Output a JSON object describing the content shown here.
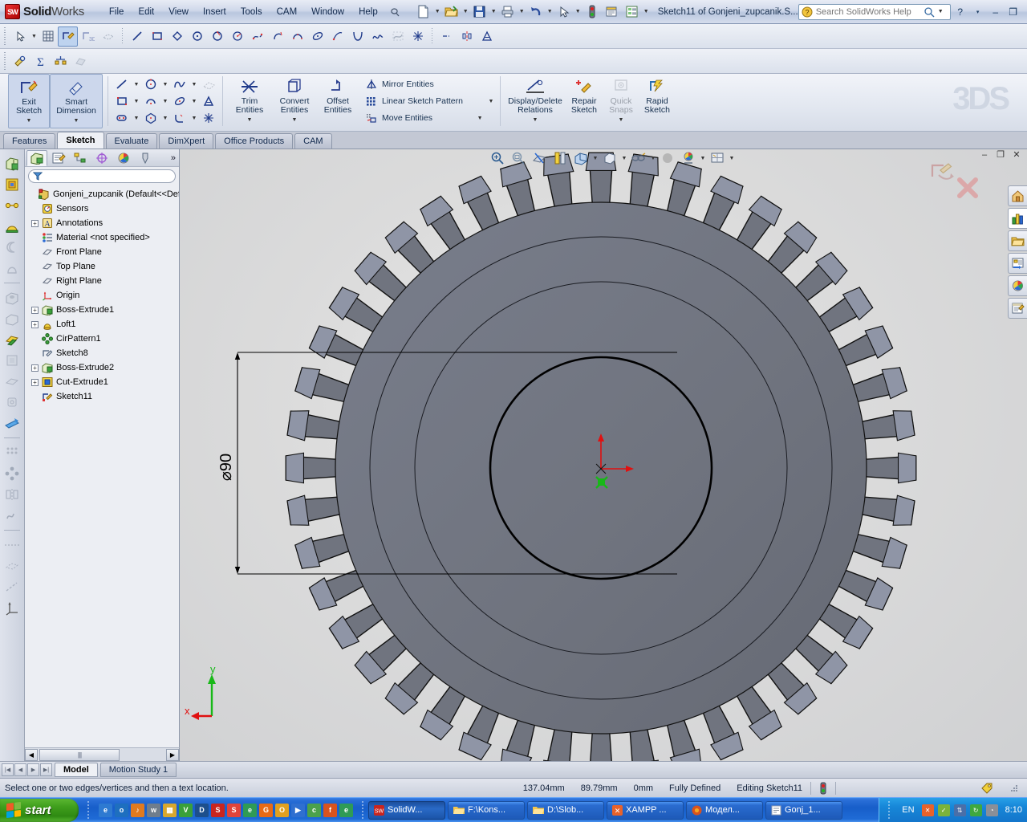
{
  "app": {
    "brand_bold": "Solid",
    "brand_light": "Works",
    "document_title": "Sketch11 of Gonjeni_zupcanik.S...",
    "accent": "#1f5cbb",
    "model_body_color": "#70747f",
    "model_tooth_light": "#8f95a6"
  },
  "menu": {
    "items": [
      {
        "label": "File"
      },
      {
        "label": "Edit"
      },
      {
        "label": "View"
      },
      {
        "label": "Insert"
      },
      {
        "label": "Tools"
      },
      {
        "label": "CAM"
      },
      {
        "label": "Window"
      },
      {
        "label": "Help"
      }
    ],
    "pin_icon": "pin-icon"
  },
  "quick_toolbar": {
    "items": [
      {
        "icon": "new-document-icon",
        "caret": true
      },
      {
        "icon": "open-folder-icon",
        "caret": true
      },
      {
        "icon": "save-icon",
        "caret": true
      },
      {
        "icon": "print-icon",
        "caret": true
      },
      {
        "icon": "undo-icon",
        "caret": true
      },
      {
        "icon": "select-arrow-icon",
        "caret": true
      },
      {
        "icon": "rebuild-icon",
        "caret": false
      },
      {
        "icon": "options-icon",
        "caret": false
      },
      {
        "icon": "document-properties-icon",
        "caret": true
      }
    ]
  },
  "search": {
    "placeholder": "Search SolidWorks Help",
    "icon": "help-search-icon",
    "magnifier_icon": "magnifier-icon",
    "dropdown_icon": "chevron-down-icon"
  },
  "window_controls": {
    "help": "?",
    "help_caret": "▾",
    "minimize": "–",
    "restore": "❐",
    "close": "✕"
  },
  "sketch_toolbar": {
    "tools": [
      "select-arrow-icon",
      "grid-icon",
      "edit-sketch-icon",
      "3d-sketch-icon",
      "sketch-on-plane-icon",
      "line-icon",
      "rectangle-icon",
      "parallelogram-icon",
      "circle-icon",
      "perimeter-circle-icon",
      "centerpoint-arc-icon",
      "spline-icon",
      "tangent-arc-icon",
      "3point-arc-icon",
      "ellipse-icon",
      "partial-ellipse-icon",
      "parabola-icon",
      "spline-curve-icon",
      "equation-curve-icon",
      "point-icon",
      "centerline-icon",
      "mirror-icon",
      "text-icon"
    ]
  },
  "evaluate_toolbar": {
    "tools": [
      "measure-icon",
      "mass-properties-icon",
      "section-properties-icon",
      "check-icon"
    ]
  },
  "ribbon": {
    "exit_sketch": {
      "label_line1": "Exit",
      "label_line2": "Sketch",
      "icon": "exit-sketch-icon"
    },
    "smart_dimension": {
      "label_line1": "Smart",
      "label_line2": "Dimension",
      "icon": "smart-dimension-icon"
    },
    "entity_tools": [
      "line-icon",
      "circle-icon",
      "spline-icon",
      "3d-sketch-plane-icon",
      "rectangle-icon",
      "centerpoint-arc-icon",
      "ellipse-icon",
      "text-icon",
      "slot-icon",
      "polygon-icon",
      "fillet-icon",
      "point-icon"
    ],
    "trim_entities": {
      "label_line1": "Trim",
      "label_line2": "Entities",
      "icon": "trim-entities-icon"
    },
    "convert_entities": {
      "label_line1": "Convert",
      "label_line2": "Entities",
      "icon": "convert-entities-icon"
    },
    "offset_entities": {
      "label_line1": "Offset",
      "label_line2": "Entities",
      "icon": "offset-entities-icon"
    },
    "small_commands": [
      {
        "label": "Mirror Entities",
        "icon": "mirror-entities-icon",
        "dropdown": false
      },
      {
        "label": "Linear Sketch Pattern",
        "icon": "linear-sketch-pattern-icon",
        "dropdown": true
      },
      {
        "label": "Move Entities",
        "icon": "move-entities-icon",
        "dropdown": true
      }
    ],
    "display_delete_relations": {
      "label_line1": "Display/Delete",
      "label_line2": "Relations",
      "icon": "display-delete-relations-icon"
    },
    "repair_sketch": {
      "label_line1": "Repair",
      "label_line2": "Sketch",
      "icon": "repair-sketch-icon"
    },
    "quick_snaps": {
      "label_line1": "Quick",
      "label_line2": "Snaps",
      "icon": "quick-snaps-icon",
      "disabled": true
    },
    "rapid_sketch": {
      "label_line1": "Rapid",
      "label_line2": "Sketch",
      "icon": "rapid-sketch-icon"
    }
  },
  "command_tabs": {
    "items": [
      {
        "label": "Features",
        "active": false
      },
      {
        "label": "Sketch",
        "active": true
      },
      {
        "label": "Evaluate",
        "active": false
      },
      {
        "label": "DimXpert",
        "active": false
      },
      {
        "label": "Office Products",
        "active": false
      },
      {
        "label": "CAM",
        "active": false
      }
    ]
  },
  "left_strip": {
    "icons": [
      "extruded-boss-icon",
      "revolved-boss-icon",
      "swept-boss-icon",
      "lofted-boss-icon",
      "boundary-boss-icon",
      "extruded-cut-icon",
      "hole-wizard-icon",
      "revolved-cut-icon",
      "swept-cut-icon",
      "lofted-cut-icon",
      "boundary-cut-icon",
      "fillet-icon",
      "chamfer-icon",
      "rib-icon",
      "draft-icon",
      "shell-icon",
      "mirror-icon",
      "linear-pattern-icon",
      "wrap-icon",
      "dome-icon",
      "reference-geometry-icon",
      "curves-icon",
      "instant3d-icon"
    ]
  },
  "feature_manager": {
    "tabs": [
      {
        "icon": "feature-tree-icon",
        "selected": true
      },
      {
        "icon": "property-manager-icon",
        "selected": false
      },
      {
        "icon": "configuration-manager-icon",
        "selected": false
      },
      {
        "icon": "dimxpert-manager-icon",
        "selected": false
      },
      {
        "icon": "display-manager-icon",
        "selected": false
      },
      {
        "icon": "cam-manager-icon",
        "selected": false
      }
    ],
    "more_icon": "chevron-right-double-icon",
    "filter_icon": "filter-icon",
    "filter_value": "",
    "tree": [
      {
        "label": "Gonjeni_zupcanik  (Default<<Defa",
        "icon": "part-icon",
        "expander": "none",
        "indent": 0
      },
      {
        "label": "Sensors",
        "icon": "sensors-icon",
        "expander": "none",
        "indent": 1
      },
      {
        "label": "Annotations",
        "icon": "annotations-icon",
        "expander": "+",
        "indent": 1
      },
      {
        "label": "Material <not specified>",
        "icon": "material-icon",
        "expander": "none",
        "indent": 1
      },
      {
        "label": "Front Plane",
        "icon": "plane-icon",
        "expander": "none",
        "indent": 1
      },
      {
        "label": "Top Plane",
        "icon": "plane-icon",
        "expander": "none",
        "indent": 1
      },
      {
        "label": "Right Plane",
        "icon": "plane-icon",
        "expander": "none",
        "indent": 1
      },
      {
        "label": "Origin",
        "icon": "origin-icon",
        "expander": "none",
        "indent": 1
      },
      {
        "label": "Boss-Extrude1",
        "icon": "boss-extrude-icon",
        "expander": "+",
        "indent": 1
      },
      {
        "label": "Loft1",
        "icon": "loft-icon",
        "expander": "+",
        "indent": 1
      },
      {
        "label": "CirPattern1",
        "icon": "circular-pattern-icon",
        "expander": "none",
        "indent": 1
      },
      {
        "label": "Sketch8",
        "icon": "sketch-icon",
        "expander": "none",
        "indent": 1
      },
      {
        "label": "Boss-Extrude2",
        "icon": "boss-extrude-icon",
        "expander": "+",
        "indent": 1
      },
      {
        "label": "Cut-Extrude1",
        "icon": "cut-extrude-icon",
        "expander": "+",
        "indent": 1
      },
      {
        "label": "Sketch11",
        "icon": "active-sketch-icon",
        "expander": "none",
        "indent": 1
      }
    ],
    "hscroll": {
      "left_arrow": "◀",
      "right_arrow": "▶",
      "thumb_grip": "||||"
    }
  },
  "view_toolbar": {
    "items": [
      {
        "icon": "zoom-to-fit-icon",
        "caret": false
      },
      {
        "icon": "zoom-to-area-icon",
        "caret": false
      },
      {
        "icon": "section-view-icon",
        "caret": false
      },
      {
        "icon": "view-orientation-icon",
        "caret": false
      },
      {
        "icon": "display-style-icon",
        "caret": true
      },
      {
        "icon": "hide-show-items-icon",
        "caret": true
      },
      {
        "icon": "edit-appearance-icon",
        "caret": true
      },
      {
        "icon": "apply-scene-icon",
        "caret": true
      },
      {
        "icon": "view-settings-icon",
        "caret": true
      }
    ]
  },
  "task_pane": {
    "buttons": [
      {
        "icon": "solidworks-resources-icon",
        "selected": false
      },
      {
        "icon": "design-library-icon",
        "selected": true
      },
      {
        "icon": "file-explorer-icon",
        "selected": false
      },
      {
        "icon": "search-results-icon",
        "selected": false
      },
      {
        "icon": "appearances-scenes-icon",
        "selected": false
      },
      {
        "icon": "custom-properties-icon",
        "selected": false
      }
    ]
  },
  "graphics": {
    "confirm_corner": {
      "ok_icon": "sketch-confirm-icon",
      "cancel_icon": "cancel-x-icon"
    },
    "dimension": {
      "value": "90",
      "symbol": "⌀",
      "full": "⌀90"
    },
    "triad": {
      "x_label": "x",
      "y_label": "y"
    },
    "watermark": "3DS",
    "gear": {
      "teeth": 44,
      "body_color": "#70747f",
      "tooth_face_color": "#8f95a6",
      "edge_color": "#111111"
    }
  },
  "bottom_tabs": {
    "nav": [
      "|◀",
      "◀",
      "▶",
      "▶|"
    ],
    "items": [
      {
        "label": "Model",
        "active": true
      },
      {
        "label": "Motion Study 1",
        "active": false
      }
    ]
  },
  "status_bar": {
    "message": "Select one or two edges/vertices and then a text location.",
    "x_value": "137.04mm",
    "y_value": "89.79mm",
    "z_value": "0mm",
    "state": "Fully Defined",
    "editing": "Editing Sketch11",
    "rebuild_icon": "rebuild-indicator-icon",
    "tag_icon": "tag-icon"
  },
  "taskbar": {
    "start_label": "start",
    "quick_launch": [
      {
        "icon": "internet-explorer-icon",
        "color": "#2e7ad1"
      },
      {
        "icon": "outlook-icon",
        "color": "#1e6fbf"
      },
      {
        "icon": "media-icon",
        "color": "#e07a1f"
      },
      {
        "icon": "winamp-icon",
        "color": "#6f7d8c"
      },
      {
        "icon": "excel-chart-icon",
        "color": "#d8a72e"
      },
      {
        "icon": "visio-icon",
        "color": "#3aa03a"
      },
      {
        "icon": "draftsight-icon",
        "color": "#1d4f8c"
      },
      {
        "icon": "solidworks-icon",
        "color": "#c9251f"
      },
      {
        "icon": "solidworks-explorer-icon",
        "color": "#e2443a"
      },
      {
        "icon": "edge-icon",
        "color": "#2f9b55"
      },
      {
        "icon": "google-icon",
        "color": "#e86a15"
      },
      {
        "icon": "opera-mail-icon",
        "color": "#e0a020"
      },
      {
        "icon": "media-player-icon",
        "color": "#2f6fd0"
      },
      {
        "icon": "chrome-icon",
        "color": "#4ba14b"
      },
      {
        "icon": "firefox-icon",
        "color": "#d9531e"
      },
      {
        "icon": "edge-legacy-icon",
        "color": "#2f9b55"
      }
    ],
    "buttons": [
      {
        "label": "SolidW...",
        "icon": "solidworks-icon",
        "active": true
      },
      {
        "label": "F:\\Kons...",
        "icon": "folder-icon",
        "active": false
      },
      {
        "label": "D:\\Slob...",
        "icon": "folder-icon",
        "active": false
      },
      {
        "label": "XAMPP ...",
        "icon": "xampp-icon",
        "active": false
      },
      {
        "label": "Модел...",
        "icon": "firefox-icon",
        "active": false
      },
      {
        "label": "Gonj_1...",
        "icon": "notepad-icon",
        "active": false
      }
    ],
    "language": "EN",
    "tray_icons": [
      {
        "icon": "xampp-tray-icon",
        "color": "#e8622a"
      },
      {
        "icon": "antivirus-tray-icon",
        "color": "#7bb33a"
      },
      {
        "icon": "network-tray-icon",
        "color": "#4a6fa8"
      },
      {
        "icon": "sync-tray-icon",
        "color": "#3fa83f"
      },
      {
        "icon": "shield-tray-icon",
        "color": "#8a8f98"
      }
    ],
    "clock": "8:10"
  }
}
